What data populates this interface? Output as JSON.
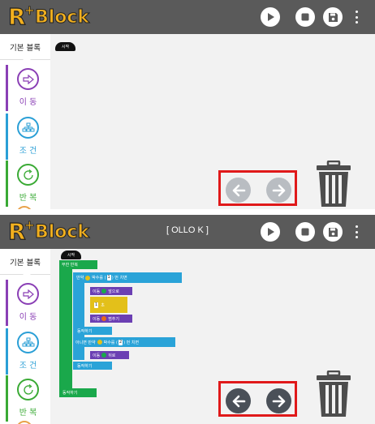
{
  "app": {
    "logo_r": "R",
    "logo_plus": "+",
    "logo_text": "Block"
  },
  "toolbar": {
    "play_icon": "play-icon",
    "stop_icon": "stop-icon",
    "save_icon": "save-icon",
    "menu_icon": "more-vert-icon"
  },
  "panels": [
    {
      "title": "",
      "sidebar": {
        "tab": "기본 블록",
        "categories": [
          {
            "label": "이 동",
            "icon": "move-arrow-icon",
            "color": "#8a3fb5"
          },
          {
            "label": "조 건",
            "icon": "condition-tree-icon",
            "color": "#2a9fd6"
          },
          {
            "label": "반 복",
            "icon": "repeat-icon",
            "color": "#3aaa35"
          }
        ]
      },
      "start_label": "시작"
    },
    {
      "title": "[ OLLO K ]",
      "sidebar": {
        "tab": "기본 블록",
        "categories": [
          {
            "label": "이 동",
            "icon": "move-arrow-icon",
            "color": "#8a3fb5"
          },
          {
            "label": "조 건",
            "icon": "condition-tree-icon",
            "color": "#2a9fd6"
          },
          {
            "label": "반 복",
            "icon": "repeat-icon",
            "color": "#3aaa35"
          }
        ]
      },
      "start_label": "시작",
      "program": {
        "loop": "무한 반복",
        "if_label": "만약",
        "if_text": "박수를 (",
        "if_num": "1",
        "if_tail": ") 번 치면",
        "move1": "이동",
        "move1_dir": "앞으로",
        "wait_num": "1",
        "wait_unit": "초",
        "move2": "이동",
        "move2_dir": "멈추기",
        "end1": "동작하기",
        "elseif_label": "아니면 만약",
        "elseif_text": "박수를 (",
        "elseif_num": "2",
        "elseif_tail": ") 번 치면",
        "move3": "이동",
        "move3_dir": "뒤로",
        "end2": "동작하기",
        "end3": "동작하기"
      }
    }
  ],
  "nav": {
    "prev_icon": "arrow-left-icon",
    "next_icon": "arrow-right-icon",
    "trash_icon": "trash-icon"
  }
}
